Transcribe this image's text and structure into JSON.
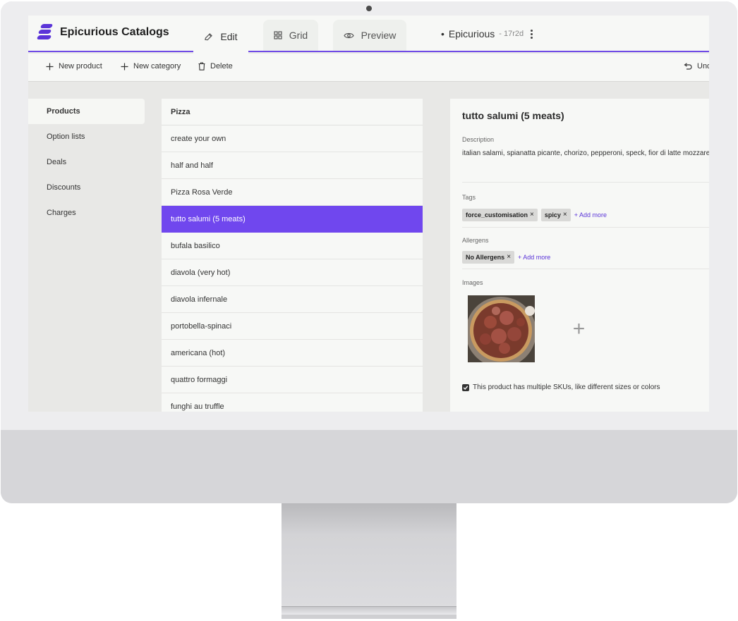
{
  "app": {
    "name": "Epicurious Catalogs",
    "brand_color": "#5b35d8",
    "accent_color": "#7047ee"
  },
  "tabs": [
    {
      "label": "Edit",
      "icon": "pencil-icon",
      "active": true
    },
    {
      "label": "Grid",
      "icon": "grid-icon",
      "active": false
    },
    {
      "label": "Preview",
      "icon": "eye-icon",
      "active": false
    }
  ],
  "document": {
    "dot": "•",
    "name": "Epicurious",
    "version": "- 17r2d"
  },
  "toolbar": {
    "new_product": "New product",
    "new_category": "New category",
    "delete": "Delete",
    "undo": "Undo"
  },
  "sidebar": {
    "items": [
      {
        "label": "Products",
        "active": true
      },
      {
        "label": "Option lists",
        "active": false
      },
      {
        "label": "Deals",
        "active": false
      },
      {
        "label": "Discounts",
        "active": false
      },
      {
        "label": "Charges",
        "active": false
      }
    ]
  },
  "product_list": {
    "category": "Pizza",
    "items": [
      {
        "label": "create your own",
        "selected": false
      },
      {
        "label": "half and half",
        "selected": false
      },
      {
        "label": "Pizza Rosa Verde",
        "selected": false
      },
      {
        "label": "tutto salumi (5 meats)",
        "selected": true
      },
      {
        "label": "bufala basilico",
        "selected": false
      },
      {
        "label": "diavola (very hot)",
        "selected": false
      },
      {
        "label": "diavola infernale",
        "selected": false
      },
      {
        "label": "portobella-spinaci",
        "selected": false
      },
      {
        "label": "americana (hot)",
        "selected": false
      },
      {
        "label": "quattro formaggi",
        "selected": false
      },
      {
        "label": "funghi au truffle",
        "selected": false
      }
    ]
  },
  "detail": {
    "title": "tutto salumi (5 meats)",
    "description_label": "Description",
    "description": "italian salami, spianatta picante, chorizo, pepperoni, speck, fior di latte mozzarella",
    "tags_label": "Tags",
    "tags": [
      "force_customisation",
      "spicy"
    ],
    "add_more": "+ Add more",
    "allergens_label": "Allergens",
    "allergens": [
      "No Allergens"
    ],
    "images_label": "Images",
    "add_image": "+",
    "multiple_skus_label": "This product has multiple SKUs, like different sizes or colors",
    "multiple_skus_checked": true
  }
}
